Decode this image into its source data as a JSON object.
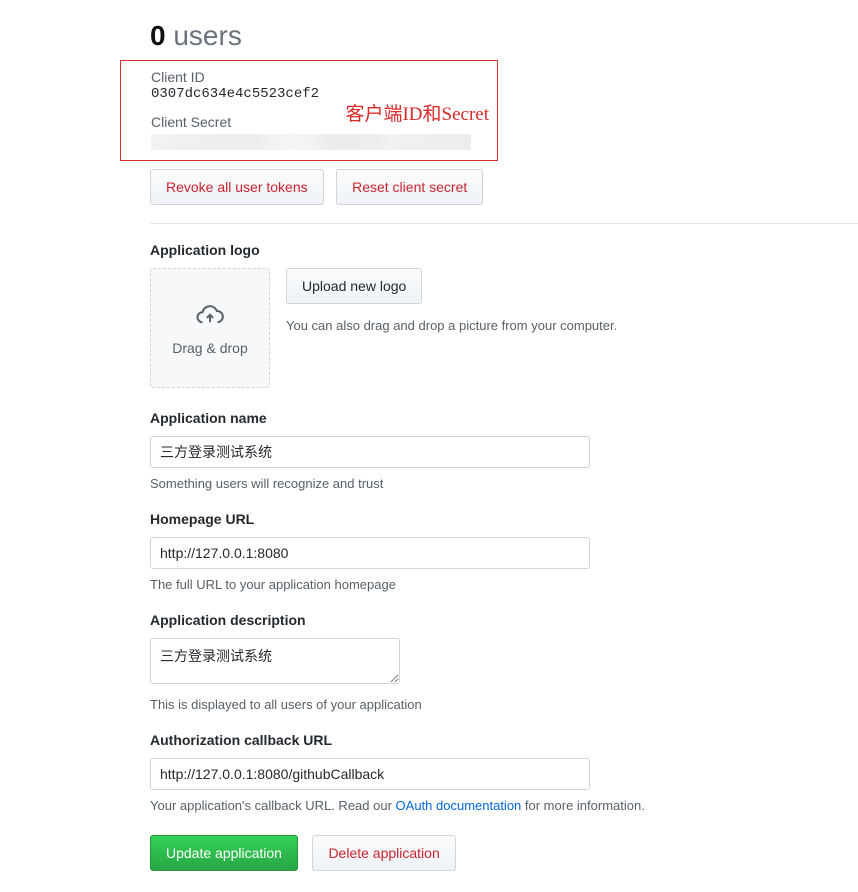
{
  "header": {
    "user_count": "0",
    "user_label": " users"
  },
  "credentials": {
    "client_id_label": "Client ID",
    "client_id_value": "0307dc634e4c5523cef2",
    "client_secret_label": "Client Secret",
    "annotation": "客户端ID和Secret"
  },
  "buttons": {
    "revoke_tokens": "Revoke all user tokens",
    "reset_secret": "Reset client secret",
    "upload_logo": "Upload new logo",
    "update_app": "Update application",
    "delete_app": "Delete application"
  },
  "logo_section": {
    "heading": "Application logo",
    "dropzone_label": "Drag & drop",
    "note": "You can also drag and drop a picture from your computer."
  },
  "form": {
    "app_name_label": "Application name",
    "app_name_value": "三方登录测试系统",
    "app_name_help": "Something users will recognize and trust",
    "homepage_label": "Homepage URL",
    "homepage_value": "http://127.0.0.1:8080",
    "homepage_help": "The full URL to your application homepage",
    "description_label": "Application description",
    "description_value": "三方登录测试系统",
    "description_help": "This is displayed to all users of your application",
    "callback_label": "Authorization callback URL",
    "callback_value": "http://127.0.0.1:8080/githubCallback",
    "callback_help_pre": "Your application's callback URL. Read our ",
    "callback_help_link": "OAuth documentation",
    "callback_help_post": " for more information."
  }
}
